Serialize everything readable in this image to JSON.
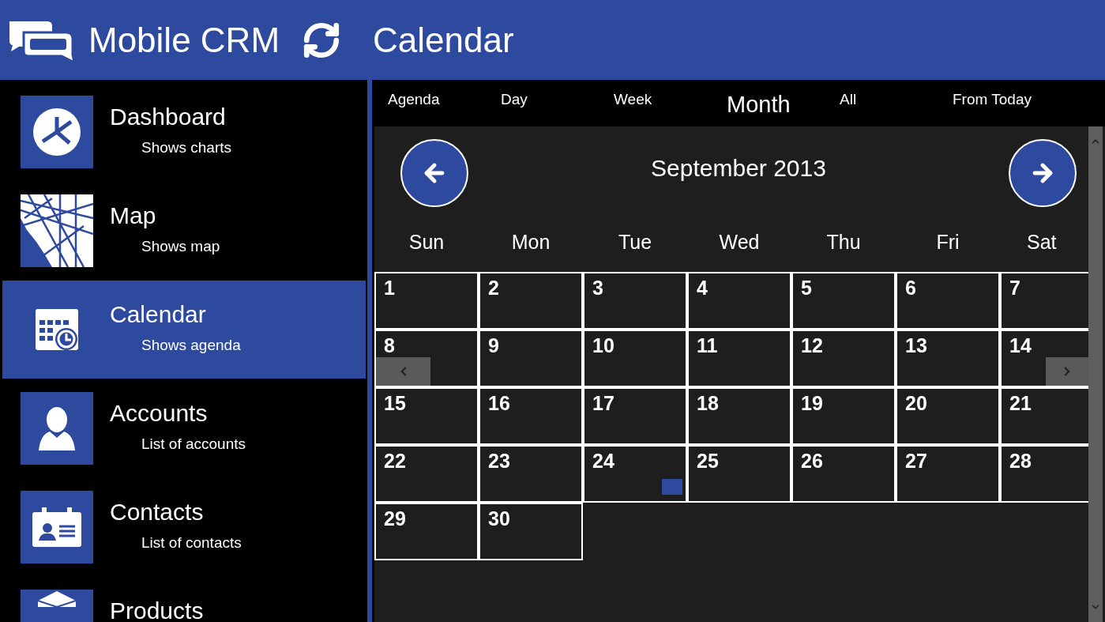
{
  "header": {
    "app_name": "Mobile CRM",
    "page_title": "Calendar"
  },
  "nav_items": [
    {
      "kind": "dashboard",
      "title": "Dashboard",
      "subtitle": "Shows charts",
      "selected": false
    },
    {
      "kind": "map",
      "title": "Map",
      "subtitle": "Shows map",
      "selected": false
    },
    {
      "kind": "calendar",
      "title": "Calendar",
      "subtitle": "Shows agenda",
      "selected": true
    },
    {
      "kind": "accounts",
      "title": "Accounts",
      "subtitle": "List of accounts",
      "selected": false
    },
    {
      "kind": "contacts",
      "title": "Contacts",
      "subtitle": "List of contacts",
      "selected": false
    },
    {
      "kind": "products",
      "title": "Products",
      "selected": false
    }
  ],
  "view_tabs": [
    {
      "label": "Agenda",
      "selected": false
    },
    {
      "label": "Day",
      "selected": false
    },
    {
      "label": "Week",
      "selected": false
    },
    {
      "label": "Month",
      "selected": true
    },
    {
      "label": "All",
      "selected": false
    },
    {
      "label": "From Today",
      "selected": false
    }
  ],
  "calendar": {
    "month_label": "September 2013",
    "weekdays": [
      "Sun",
      "Mon",
      "Tue",
      "Wed",
      "Thu",
      "Fri",
      "Sat"
    ],
    "days": [
      {
        "label": "1",
        "has_event": false
      },
      {
        "label": "2",
        "has_event": false
      },
      {
        "label": "3",
        "has_event": false
      },
      {
        "label": "4",
        "has_event": false
      },
      {
        "label": "5",
        "has_event": false
      },
      {
        "label": "6",
        "has_event": false
      },
      {
        "label": "7",
        "has_event": false
      },
      {
        "label": "8",
        "has_event": false
      },
      {
        "label": "9",
        "has_event": false
      },
      {
        "label": "10",
        "has_event": false
      },
      {
        "label": "11",
        "has_event": false
      },
      {
        "label": "12",
        "has_event": false
      },
      {
        "label": "13",
        "has_event": false
      },
      {
        "label": "14",
        "has_event": false
      },
      {
        "label": "15",
        "has_event": false
      },
      {
        "label": "16",
        "has_event": false
      },
      {
        "label": "17",
        "has_event": false
      },
      {
        "label": "18",
        "has_event": false
      },
      {
        "label": "19",
        "has_event": false
      },
      {
        "label": "20",
        "has_event": false
      },
      {
        "label": "21",
        "has_event": false
      },
      {
        "label": "22",
        "has_event": false
      },
      {
        "label": "23",
        "has_event": false
      },
      {
        "label": "24",
        "has_event": true
      },
      {
        "label": "25",
        "has_event": false
      },
      {
        "label": "26",
        "has_event": false
      },
      {
        "label": "27",
        "has_event": false
      },
      {
        "label": "28",
        "has_event": false
      },
      {
        "label": "29",
        "has_event": false
      },
      {
        "label": "30",
        "has_event": false
      }
    ]
  }
}
